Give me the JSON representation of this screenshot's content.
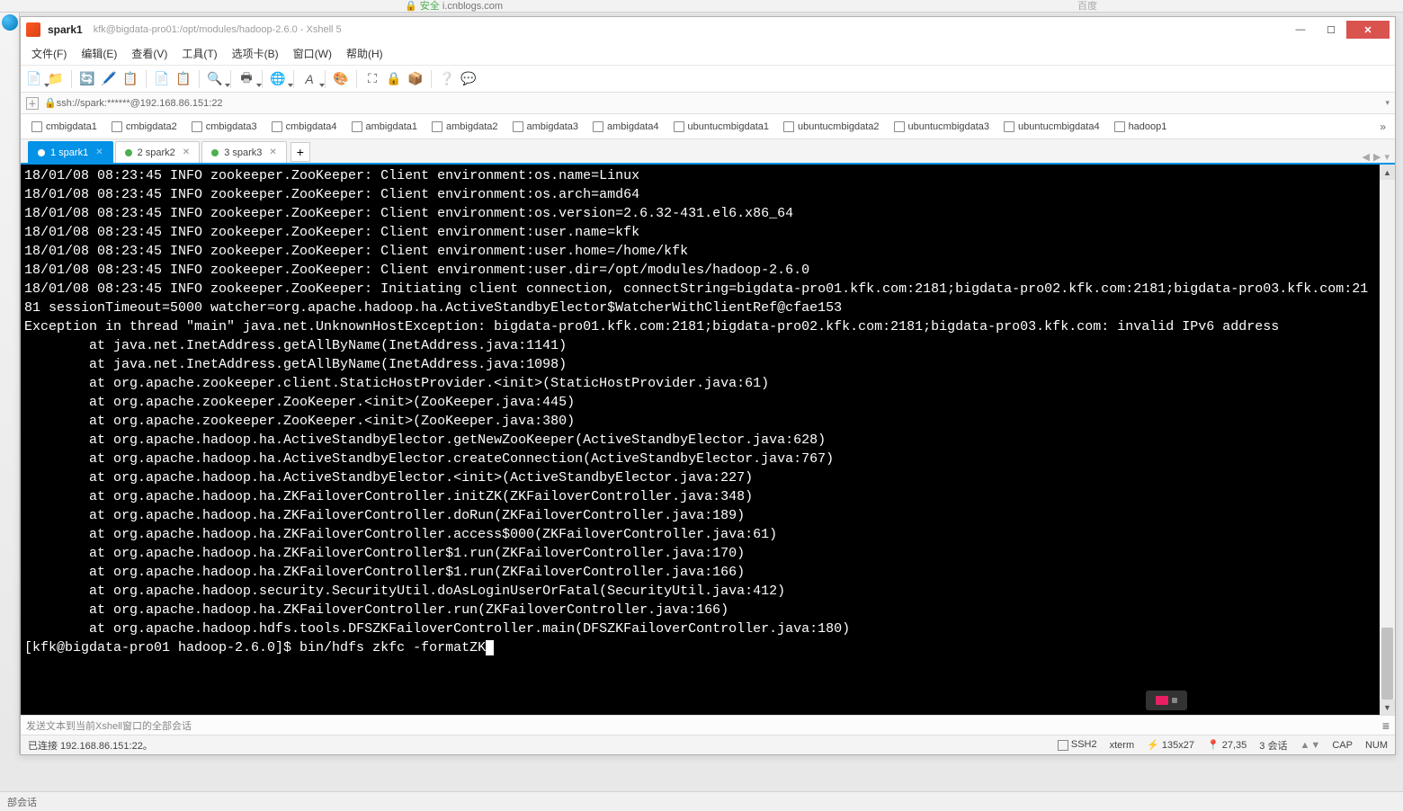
{
  "browser": {
    "url": "i.cnblogs.com",
    "search_placeholder": "百度",
    "secure_label": "安全"
  },
  "window": {
    "title": "spark1",
    "subtitle": "kfk@bigdata-pro01:/opt/modules/hadoop-2.6.0 - Xshell 5"
  },
  "menu": {
    "file": "文件(F)",
    "edit": "编辑(E)",
    "view": "查看(V)",
    "tools": "工具(T)",
    "tabs": "选项卡(B)",
    "window": "窗口(W)",
    "help": "帮助(H)"
  },
  "quick": {
    "ssh": "ssh://spark:******@192.168.86.151:22"
  },
  "host_tabs": [
    "cmbigdata1",
    "cmbigdata2",
    "cmbigdata3",
    "cmbigdata4",
    "ambigdata1",
    "ambigdata2",
    "ambigdata3",
    "ambigdata4",
    "ubuntucmbigdata1",
    "ubuntucmbigdata2",
    "ubuntucmbigdata3",
    "ubuntucmbigdata4",
    "hadoop1"
  ],
  "session_tabs": [
    {
      "label": "1 spark1",
      "active": true
    },
    {
      "label": "2 spark2",
      "active": false
    },
    {
      "label": "3 spark3",
      "active": false
    }
  ],
  "terminal_lines": [
    "18/01/08 08:23:45 INFO zookeeper.ZooKeeper: Client environment:os.name=Linux",
    "18/01/08 08:23:45 INFO zookeeper.ZooKeeper: Client environment:os.arch=amd64",
    "18/01/08 08:23:45 INFO zookeeper.ZooKeeper: Client environment:os.version=2.6.32-431.el6.x86_64",
    "18/01/08 08:23:45 INFO zookeeper.ZooKeeper: Client environment:user.name=kfk",
    "18/01/08 08:23:45 INFO zookeeper.ZooKeeper: Client environment:user.home=/home/kfk",
    "18/01/08 08:23:45 INFO zookeeper.ZooKeeper: Client environment:user.dir=/opt/modules/hadoop-2.6.0",
    "18/01/08 08:23:45 INFO zookeeper.ZooKeeper: Initiating client connection, connectString=bigdata-pro01.kfk.com:2181;bigdata-pro02.kfk.com:2181;bigdata-pro03.kfk.com:2181 sessionTimeout=5000 watcher=org.apache.hadoop.ha.ActiveStandbyElector$WatcherWithClientRef@cfae153",
    "Exception in thread \"main\" java.net.UnknownHostException: bigdata-pro01.kfk.com:2181;bigdata-pro02.kfk.com:2181;bigdata-pro03.kfk.com: invalid IPv6 address",
    "        at java.net.InetAddress.getAllByName(InetAddress.java:1141)",
    "        at java.net.InetAddress.getAllByName(InetAddress.java:1098)",
    "        at org.apache.zookeeper.client.StaticHostProvider.<init>(StaticHostProvider.java:61)",
    "        at org.apache.zookeeper.ZooKeeper.<init>(ZooKeeper.java:445)",
    "        at org.apache.zookeeper.ZooKeeper.<init>(ZooKeeper.java:380)",
    "        at org.apache.hadoop.ha.ActiveStandbyElector.getNewZooKeeper(ActiveStandbyElector.java:628)",
    "        at org.apache.hadoop.ha.ActiveStandbyElector.createConnection(ActiveStandbyElector.java:767)",
    "        at org.apache.hadoop.ha.ActiveStandbyElector.<init>(ActiveStandbyElector.java:227)",
    "        at org.apache.hadoop.ha.ZKFailoverController.initZK(ZKFailoverController.java:348)",
    "        at org.apache.hadoop.ha.ZKFailoverController.doRun(ZKFailoverController.java:189)",
    "        at org.apache.hadoop.ha.ZKFailoverController.access$000(ZKFailoverController.java:61)",
    "        at org.apache.hadoop.ha.ZKFailoverController$1.run(ZKFailoverController.java:170)",
    "        at org.apache.hadoop.ha.ZKFailoverController$1.run(ZKFailoverController.java:166)",
    "        at org.apache.hadoop.security.SecurityUtil.doAsLoginUserOrFatal(SecurityUtil.java:412)",
    "        at org.apache.hadoop.ha.ZKFailoverController.run(ZKFailoverController.java:166)",
    "        at org.apache.hadoop.hdfs.tools.DFSZKFailoverController.main(DFSZKFailoverController.java:180)"
  ],
  "prompt": "[kfk@bigdata-pro01 hadoop-2.6.0]$ bin/hdfs zkfc -formatZK",
  "compose_placeholder": "发送文本到当前Xshell窗口的全部会话",
  "status": {
    "connected": "已连接 192.168.86.151:22。",
    "proto": "SSH2",
    "term": "xterm",
    "size": "135x27",
    "cursor": "27,35",
    "sessions": "3 会话",
    "cap": "CAP",
    "num": "NUM"
  },
  "bottom_strip": "部会话"
}
